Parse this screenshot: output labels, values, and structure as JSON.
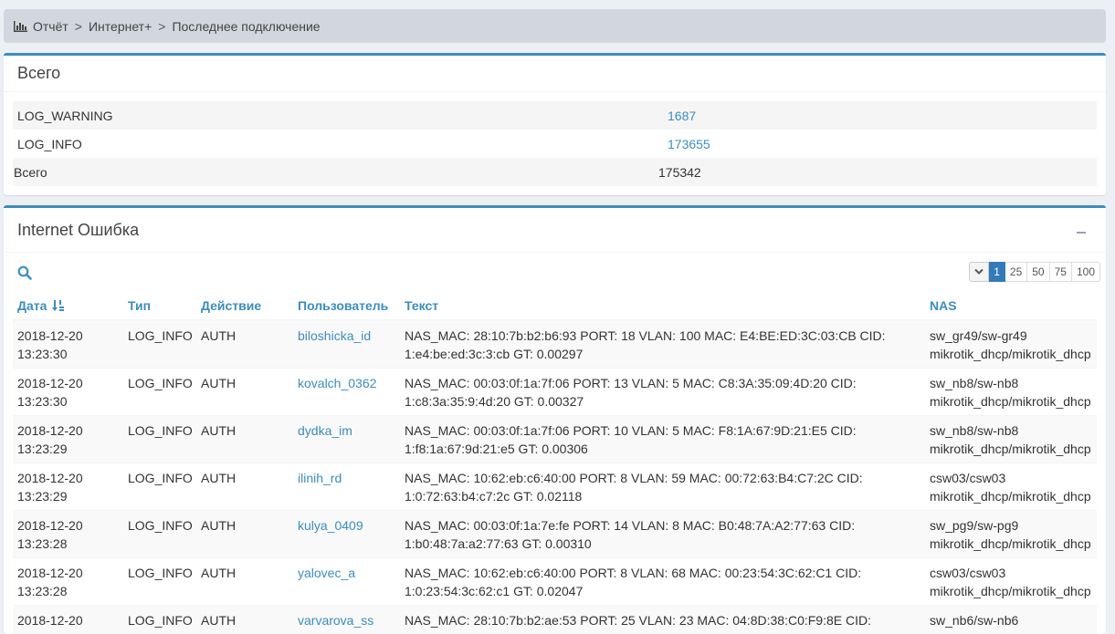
{
  "breadcrumb": {
    "items": [
      "Отчёт",
      "Интернет+",
      "Последнее подключение"
    ],
    "sep": ">"
  },
  "summary": {
    "title": "Всего",
    "rows": [
      {
        "name": "LOG_WARNING",
        "value": "1687"
      },
      {
        "name": "LOG_INFO",
        "value": "173655"
      }
    ],
    "total": {
      "name": "Всего",
      "value": "175342"
    }
  },
  "log": {
    "title": "Internet Ошибка",
    "pager": {
      "pages": [
        "1",
        "25",
        "50",
        "75",
        "100"
      ],
      "active": "1"
    },
    "columns": [
      "Дата",
      "Тип",
      "Действие",
      "Пользователь",
      "Текст",
      "NAS"
    ],
    "rows": [
      {
        "date": "2018-12-20",
        "time": "13:23:30",
        "type": "LOG_INFO",
        "action": "AUTH",
        "user": "biloshicka_id",
        "text1": "NAS_MAC: 28:10:7b:b2:b6:93 PORT: 18 VLAN: 100 MAC: E4:BE:ED:3C:03:CB CID:",
        "text2": "1:e4:be:ed:3c:3:cb GT: 0.00297",
        "nas1": "sw_gr49/sw-gr49",
        "nas2": "mikrotik_dhcp/mikrotik_dhcp"
      },
      {
        "date": "2018-12-20",
        "time": "13:23:30",
        "type": "LOG_INFO",
        "action": "AUTH",
        "user": "kovalch_0362",
        "text1": "NAS_MAC: 00:03:0f:1a:7f:06 PORT: 13 VLAN: 5 MAC: C8:3A:35:09:4D:20 CID:",
        "text2": "1:c8:3a:35:9:4d:20 GT: 0.00327",
        "nas1": "sw_nb8/sw-nb8",
        "nas2": "mikrotik_dhcp/mikrotik_dhcp"
      },
      {
        "date": "2018-12-20",
        "time": "13:23:29",
        "type": "LOG_INFO",
        "action": "AUTH",
        "user": "dydka_im",
        "text1": "NAS_MAC: 00:03:0f:1a:7f:06 PORT: 10 VLAN: 5 MAC: F8:1A:67:9D:21:E5 CID:",
        "text2": "1:f8:1a:67:9d:21:e5 GT: 0.00306",
        "nas1": "sw_nb8/sw-nb8",
        "nas2": "mikrotik_dhcp/mikrotik_dhcp"
      },
      {
        "date": "2018-12-20",
        "time": "13:23:29",
        "type": "LOG_INFO",
        "action": "AUTH",
        "user": "ilinih_rd",
        "text1": "NAS_MAC: 10:62:eb:c6:40:00 PORT: 8 VLAN: 59 MAC: 00:72:63:B4:C7:2C CID:",
        "text2": "1:0:72:63:b4:c7:2c GT: 0.02118",
        "nas1": "csw03/csw03",
        "nas2": "mikrotik_dhcp/mikrotik_dhcp"
      },
      {
        "date": "2018-12-20",
        "time": "13:23:28",
        "type": "LOG_INFO",
        "action": "AUTH",
        "user": "kulya_0409",
        "text1": "NAS_MAC: 00:03:0f:1a:7e:fe PORT: 14 VLAN: 8 MAC: B0:48:7A:A2:77:63 CID:",
        "text2": "1:b0:48:7a:a2:77:63 GT: 0.00310",
        "nas1": "sw_pg9/sw-pg9",
        "nas2": "mikrotik_dhcp/mikrotik_dhcp"
      },
      {
        "date": "2018-12-20",
        "time": "13:23:28",
        "type": "LOG_INFO",
        "action": "AUTH",
        "user": "yalovec_a",
        "text1": "NAS_MAC: 10:62:eb:c6:40:00 PORT: 8 VLAN: 68 MAC: 00:23:54:3C:62:C1 CID:",
        "text2": "1:0:23:54:3c:62:c1 GT: 0.02047",
        "nas1": "csw03/csw03",
        "nas2": "mikrotik_dhcp/mikrotik_dhcp"
      },
      {
        "date": "2018-12-20",
        "time": "",
        "type": "LOG_INFO",
        "action": "AUTH",
        "user": "varvarova_ss",
        "text1": "NAS_MAC: 28:10:7b:b2:ae:53 PORT: 25 VLAN: 23 MAC: 04:8D:38:C0:F9:8E CID:",
        "text2": "",
        "nas1": "sw_nb6/sw-nb6",
        "nas2": ""
      }
    ]
  },
  "colors": {
    "accent": "#3c8dbc",
    "pager_active": "#337ab7",
    "background": "#ecf0f5"
  },
  "icons": {
    "breadcrumb": "bar-chart-icon",
    "search": "search-icon",
    "sort": "sort-desc-icon",
    "collapse": "minus-icon",
    "pager_toggle": "chevron-down-icon"
  }
}
